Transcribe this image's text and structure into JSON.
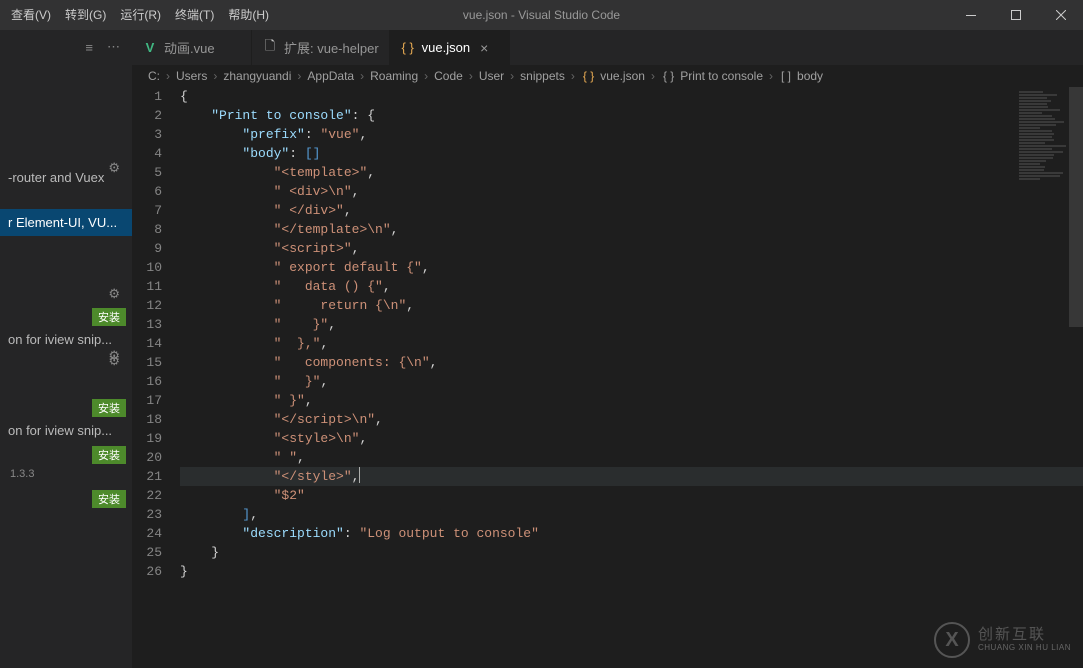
{
  "menu": {
    "view": "查看(V)",
    "goto": "转到(G)",
    "run": "运行(R)",
    "terminal": "终端(T)",
    "help": "帮助(H)"
  },
  "title": "vue.json - Visual Studio Code",
  "sidebar": {
    "row_router": "-router and Vuex",
    "row_element": "r Element-UI, VU...",
    "row_iview1": "on for iview snip...",
    "row_iview2": "on for iview snip...",
    "install": "安装",
    "version": "1.3.3"
  },
  "tabs": [
    {
      "label": "动画.vue",
      "icon": "vue",
      "glyph": "V",
      "active": false
    },
    {
      "label": "扩展: vue-helper",
      "icon": "file",
      "glyph": "🗋",
      "active": false
    },
    {
      "label": "vue.json",
      "icon": "json",
      "glyph": "{ }",
      "active": true
    }
  ],
  "breadcrumbs": {
    "parts": [
      "C:",
      "Users",
      "zhangyuandi",
      "AppData",
      "Roaming",
      "Code",
      "User",
      "snippets"
    ],
    "file_icon": "{ }",
    "file": "vue.json",
    "node_icon": "{ }",
    "node": "Print to console",
    "tail_icon": "[ ]",
    "tail": "body"
  },
  "code_lines": [
    {
      "n": 1,
      "indent": 0,
      "spans": [
        [
          "brace",
          "{"
        ]
      ]
    },
    {
      "n": 2,
      "indent": 1,
      "spans": [
        [
          "key",
          "\"Print to console\""
        ],
        [
          "punc",
          ": "
        ],
        [
          "brace",
          "{"
        ]
      ]
    },
    {
      "n": 3,
      "indent": 2,
      "spans": [
        [
          "key",
          "\"prefix\""
        ],
        [
          "punc",
          ": "
        ],
        [
          "str",
          "\"vue\""
        ],
        [
          "punc",
          ","
        ]
      ]
    },
    {
      "n": 4,
      "indent": 2,
      "spans": [
        [
          "key",
          "\"body\""
        ],
        [
          "punc",
          ": "
        ],
        [
          "bracket",
          "["
        ],
        [
          "bracket",
          "]"
        ]
      ]
    },
    {
      "n": 5,
      "indent": 3,
      "spans": [
        [
          "str",
          "\"<template>\""
        ],
        [
          "punc",
          ","
        ]
      ]
    },
    {
      "n": 6,
      "indent": 3,
      "spans": [
        [
          "str",
          "\" <div>\\n\""
        ],
        [
          "punc",
          ","
        ]
      ]
    },
    {
      "n": 7,
      "indent": 3,
      "spans": [
        [
          "str",
          "\" </div>\""
        ],
        [
          "punc",
          ","
        ]
      ]
    },
    {
      "n": 8,
      "indent": 3,
      "spans": [
        [
          "str",
          "\"</template>\\n\""
        ],
        [
          "punc",
          ","
        ]
      ]
    },
    {
      "n": 9,
      "indent": 3,
      "spans": [
        [
          "str",
          "\"<script>\""
        ],
        [
          "punc",
          ","
        ]
      ]
    },
    {
      "n": 10,
      "indent": 3,
      "spans": [
        [
          "str",
          "\" export default {\""
        ],
        [
          "punc",
          ","
        ]
      ]
    },
    {
      "n": 11,
      "indent": 3,
      "spans": [
        [
          "str",
          "\"   data () {\""
        ],
        [
          "punc",
          ","
        ]
      ]
    },
    {
      "n": 12,
      "indent": 3,
      "spans": [
        [
          "str",
          "\"     return {\\n\""
        ],
        [
          "punc",
          ","
        ]
      ]
    },
    {
      "n": 13,
      "indent": 3,
      "spans": [
        [
          "str",
          "\"    }\""
        ],
        [
          "punc",
          ","
        ]
      ]
    },
    {
      "n": 14,
      "indent": 3,
      "spans": [
        [
          "str",
          "\"  },\""
        ],
        [
          "punc",
          ","
        ]
      ]
    },
    {
      "n": 15,
      "indent": 3,
      "spans": [
        [
          "str",
          "\"   components: {\\n\""
        ],
        [
          "punc",
          ","
        ]
      ]
    },
    {
      "n": 16,
      "indent": 3,
      "spans": [
        [
          "str",
          "\"   }\""
        ],
        [
          "punc",
          ","
        ]
      ]
    },
    {
      "n": 17,
      "indent": 3,
      "spans": [
        [
          "str",
          "\" }\""
        ],
        [
          "punc",
          ","
        ]
      ]
    },
    {
      "n": 18,
      "indent": 3,
      "spans": [
        [
          "str",
          "\"</script>\\n\""
        ],
        [
          "punc",
          ","
        ]
      ]
    },
    {
      "n": 19,
      "indent": 3,
      "spans": [
        [
          "str",
          "\"<style>\\n\""
        ],
        [
          "punc",
          ","
        ]
      ]
    },
    {
      "n": 20,
      "indent": 3,
      "spans": [
        [
          "str",
          "\" \""
        ],
        [
          "punc",
          ","
        ]
      ]
    },
    {
      "n": 21,
      "indent": 3,
      "spans": [
        [
          "str",
          "\"</style>\""
        ],
        [
          "punc",
          ","
        ]
      ],
      "cursor": true,
      "hl": true
    },
    {
      "n": 22,
      "indent": 3,
      "spans": [
        [
          "str",
          "\"$2\""
        ]
      ]
    },
    {
      "n": 23,
      "indent": 2,
      "spans": [
        [
          "bracket",
          "]"
        ],
        [
          "punc",
          ","
        ]
      ]
    },
    {
      "n": 24,
      "indent": 2,
      "spans": [
        [
          "key",
          "\"description\""
        ],
        [
          "punc",
          ": "
        ],
        [
          "str",
          "\"Log output to console\""
        ]
      ]
    },
    {
      "n": 25,
      "indent": 1,
      "spans": [
        [
          "brace",
          "}"
        ]
      ]
    },
    {
      "n": 26,
      "indent": 0,
      "spans": [
        [
          "brace",
          "}"
        ]
      ]
    }
  ],
  "watermark": {
    "cn": "创新互联",
    "en": "CHUANG XIN HU LIAN",
    "icon": "X"
  }
}
